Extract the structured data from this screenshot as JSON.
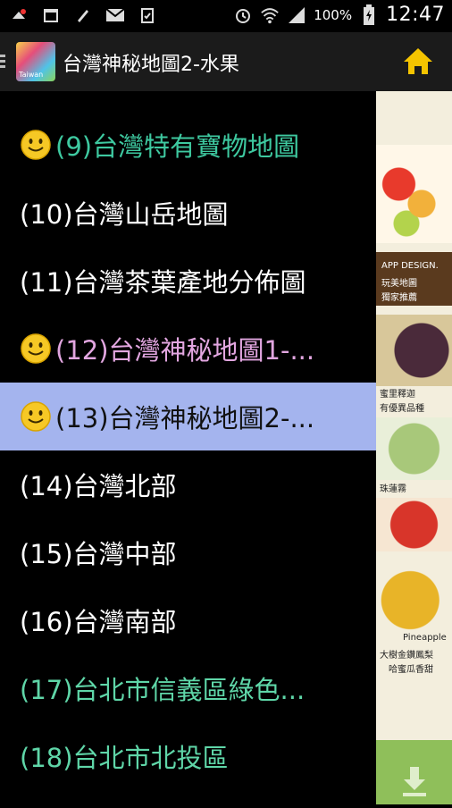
{
  "status_bar": {
    "battery_percent": "100%",
    "time": "12:47",
    "icons": [
      "upload-icon",
      "calendar-icon",
      "clean-icon",
      "mail-icon",
      "clipboard-icon",
      "alarm-icon",
      "wifi-icon",
      "signal-icon",
      "battery-icon"
    ]
  },
  "action_bar": {
    "title": "台灣神秘地圖2-水果",
    "app_icon_caption": "Taiwan",
    "home_icon": "home-icon"
  },
  "drawer": {
    "items": [
      {
        "label": "(9)台灣特有寶物地圖",
        "smiley": true,
        "color": "#3ec9a0"
      },
      {
        "label": "(10)台灣山岳地圖",
        "smiley": false,
        "color": "#ffffff"
      },
      {
        "label": "(11)台灣茶葉產地分佈圖",
        "smiley": false,
        "color": "#ffffff"
      },
      {
        "label": "(12)台灣神秘地圖1-...",
        "smiley": true,
        "color": "#e2a6e0"
      },
      {
        "label": "(13)台灣神秘地圖2-...",
        "smiley": true,
        "color": "#111111",
        "selected": true
      },
      {
        "label": "(14)台灣北部",
        "smiley": false,
        "color": "#ffffff"
      },
      {
        "label": "(15)台灣中部",
        "smiley": false,
        "color": "#ffffff"
      },
      {
        "label": "(16)台灣南部",
        "smiley": false,
        "color": "#ffffff"
      },
      {
        "label": "(17)台北市信義區綠色...",
        "smiley": false,
        "color": "#5fd6a8"
      },
      {
        "label": "(18)台北市北投區",
        "smiley": false,
        "color": "#5fd6a8"
      }
    ]
  },
  "background_content": {
    "captions": [
      "APP DESIGN.",
      "玩美地圖",
      "獨家推薦",
      "蜜里釋迦",
      "有優異品種",
      "珠蓮霧",
      "Pineapple",
      "大樹金鑽鳳梨",
      "哈蜜瓜香甜"
    ],
    "download_icon": "download-arrow-icon"
  },
  "colors": {
    "accent_selected": "#a4b4ee",
    "home_icon_yellow": "#f5c400",
    "drawer_bg": "#000000"
  }
}
